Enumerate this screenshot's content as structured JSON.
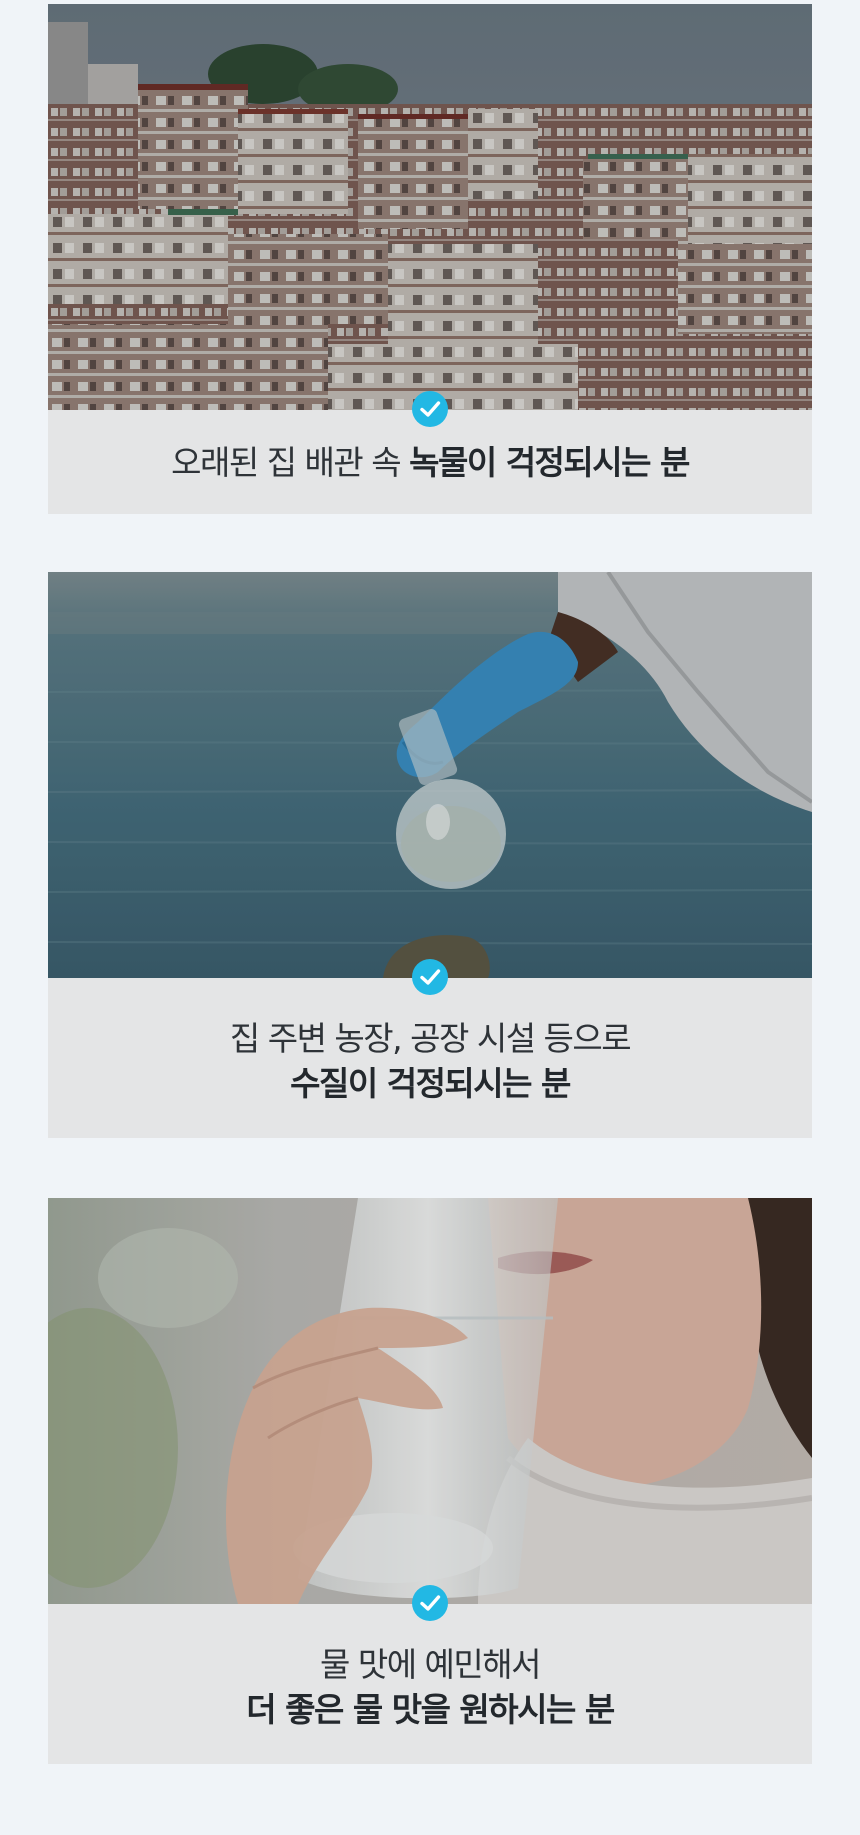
{
  "cards": [
    {
      "image": "old-houses-on-hillside-photo",
      "caption": {
        "light": "오래된 집 배관 속 ",
        "bold": "녹물이 걱정되시는 분"
      },
      "icon": "checkmark-icon"
    },
    {
      "image": "gloved-hand-water-sample-flask-photo",
      "caption": {
        "line1": "집 주변 농장, 공장 시설 등으로",
        "line2": "수질이 걱정되시는 분"
      },
      "icon": "checkmark-icon"
    },
    {
      "image": "woman-drinking-water-glass-photo",
      "caption": {
        "line1": "물 맛에 예민해서",
        "line2": "더 좋은 물 맛을 원하시는 분"
      },
      "icon": "checkmark-icon"
    }
  ],
  "colors": {
    "page_background": "#f0f4f8",
    "caption_background": "#e4e5e6",
    "check_badge": "#22b8e4",
    "text": "#2b3036"
  }
}
